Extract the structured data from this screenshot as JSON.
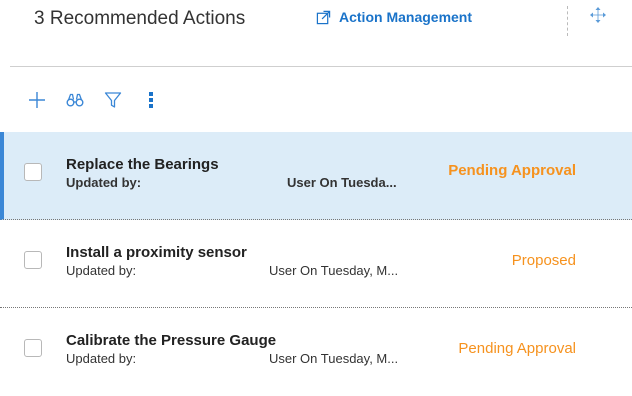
{
  "header": {
    "title": "3 Recommended Actions",
    "action_link": "Action Management"
  },
  "toolbar": {
    "icons": [
      "add-icon",
      "binoculars-icon",
      "filter-icon",
      "more-options-icon"
    ]
  },
  "list": {
    "items": [
      {
        "name": "Replace the Bearings",
        "updated_label": "Updated by:",
        "user_date": "User On  Tuesda...",
        "status": "Pending Approval",
        "selected": true
      },
      {
        "name": "Install a proximity sensor",
        "updated_label": "Updated by:",
        "user_date": "User On  Tuesday, M...",
        "status": "Proposed",
        "selected": false
      },
      {
        "name": "Calibrate the Pressure Gauge",
        "updated_label": "Updated by:",
        "user_date": "User On  Tuesday, M...",
        "status": "Pending Approval",
        "selected": false
      }
    ]
  },
  "colors": {
    "accent": "#1a73c9",
    "status": "#f6921e",
    "selected_bg": "#dcecf8",
    "selected_border": "#3b87d6",
    "icon": "#3b87d6"
  }
}
